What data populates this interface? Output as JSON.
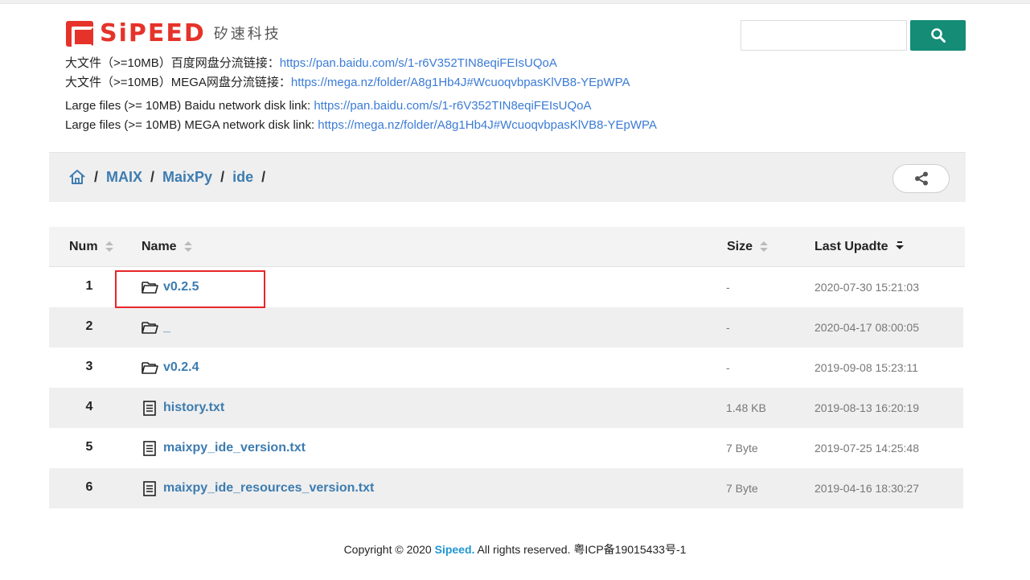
{
  "header": {
    "logo_text": "SiPEED",
    "logo_cn": "矽速科技",
    "search": {
      "placeholder": "",
      "value": ""
    }
  },
  "links": [
    {
      "label": "大文件（>=10MB）百度网盘分流链接：",
      "url": "https://pan.baidu.com/s/1-r6V352TIN8eqiFEIsUQoA"
    },
    {
      "label": "大文件（>=10MB）MEGA网盘分流链接：",
      "url": "https://mega.nz/folder/A8g1Hb4J#WcuoqvbpasKlVB8-YEpWPA"
    },
    {
      "label": "Large files (>= 10MB) Baidu network disk link: ",
      "url": "https://pan.baidu.com/s/1-r6V352TIN8eqiFEIsUQoA"
    },
    {
      "label": "Large files (>= 10MB) MEGA network disk link: ",
      "url": "https://mega.nz/folder/A8g1Hb4J#WcuoqvbpasKlVB8-YEpWPA"
    }
  ],
  "breadcrumb": {
    "items": [
      "MAIX",
      "MaixPy",
      "ide"
    ],
    "separator": "/"
  },
  "table": {
    "headers": {
      "num": "Num",
      "name": "Name",
      "size": "Size",
      "last_update": "Last Upadte"
    },
    "rows": [
      {
        "num": "1",
        "type": "folder-icon",
        "name": "v0.2.5",
        "size": "-",
        "date": "2020-07-30 15:21:03"
      },
      {
        "num": "2",
        "type": "folder-icon",
        "name": "_",
        "size": "-",
        "date": "2020-04-17 08:00:05"
      },
      {
        "num": "3",
        "type": "folder-icon",
        "name": "v0.2.4",
        "size": "-",
        "date": "2019-09-08 15:23:11"
      },
      {
        "num": "4",
        "type": "file-icon",
        "name": "history.txt",
        "size": "1.48 KB",
        "date": "2019-08-13 16:20:19"
      },
      {
        "num": "5",
        "type": "file-icon",
        "name": "maixpy_ide_version.txt",
        "size": "7 Byte",
        "date": "2019-07-25 14:25:48"
      },
      {
        "num": "6",
        "type": "file-icon",
        "name": "maixpy_ide_resources_version.txt",
        "size": "7 Byte",
        "date": "2019-04-16 18:30:27"
      }
    ]
  },
  "footer": {
    "prefix": "Copyright © 2020 ",
    "brand": "Sipeed.",
    "suffix": " All rights reserved. 粤ICP备19015433号-1"
  },
  "colors": {
    "brand_red": "#e5332a",
    "search_green": "#148c76",
    "link_blue": "#3b7bd6",
    "name_blue": "#3d7cb0",
    "highlight_red": "#e8262a"
  }
}
